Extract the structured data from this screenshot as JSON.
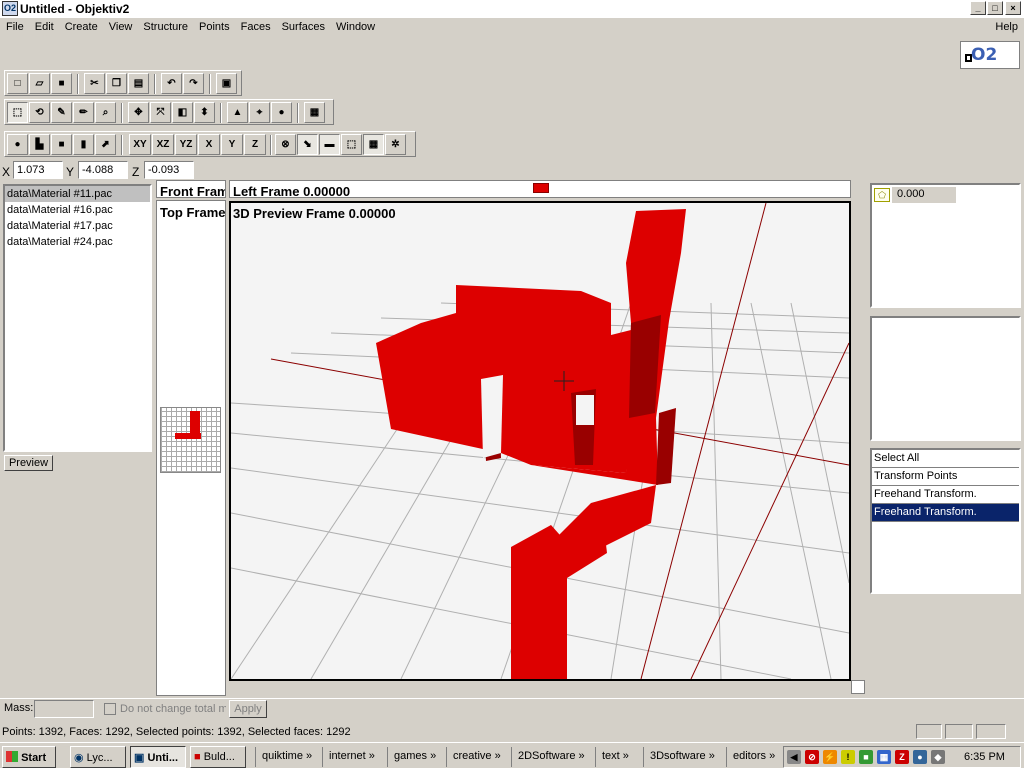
{
  "window": {
    "title": "Untitled - Objektiv2"
  },
  "menu": [
    "File",
    "Edit",
    "Create",
    "View",
    "Structure",
    "Points",
    "Faces",
    "Surfaces",
    "Window"
  ],
  "help_label": "Help",
  "logo_text": "O2",
  "axis_buttons": [
    "XY",
    "XZ",
    "YZ",
    "X",
    "Y",
    "Z"
  ],
  "coords": {
    "x_label": "X",
    "x": "1.073",
    "y_label": "Y",
    "y": "-4.088",
    "z_label": "Z",
    "z": "-0.093"
  },
  "materials": [
    "data\\Material #11.pac",
    "data\\Material #16.pac",
    "data\\Material #17.pac",
    "data\\Material #24.pac"
  ],
  "preview_label": "Preview",
  "viewports": {
    "front": "Front Frame",
    "left": "Left Frame 0.00000",
    "top": "Top Frame",
    "preview": "3D Preview Frame 0.00000"
  },
  "lod_value": "0.000",
  "selections": [
    "Select All",
    "Transform Points",
    "Freehand Transform.",
    "Freehand Transform."
  ],
  "mass": {
    "label": "Mass:",
    "checkbox_label": "Do not change total mass",
    "apply": "Apply"
  },
  "status": "Points: 1392, Faces: 1292, Selected points: 1392, Selected faces: 1292",
  "taskbar": {
    "start": "Start",
    "tasks": [
      "Lyc...",
      "Unti...",
      "Buld..."
    ],
    "quicklaunch": [
      "quiktime",
      "internet",
      "games",
      "creative",
      "2DSoftware",
      "text",
      "3Dsoftware",
      "editors"
    ],
    "clock": "6:35 PM"
  },
  "colors": {
    "accent": "#0a246a",
    "model": "#dd0000",
    "grid": "#b0b0b0",
    "axis": "#8b0000"
  }
}
